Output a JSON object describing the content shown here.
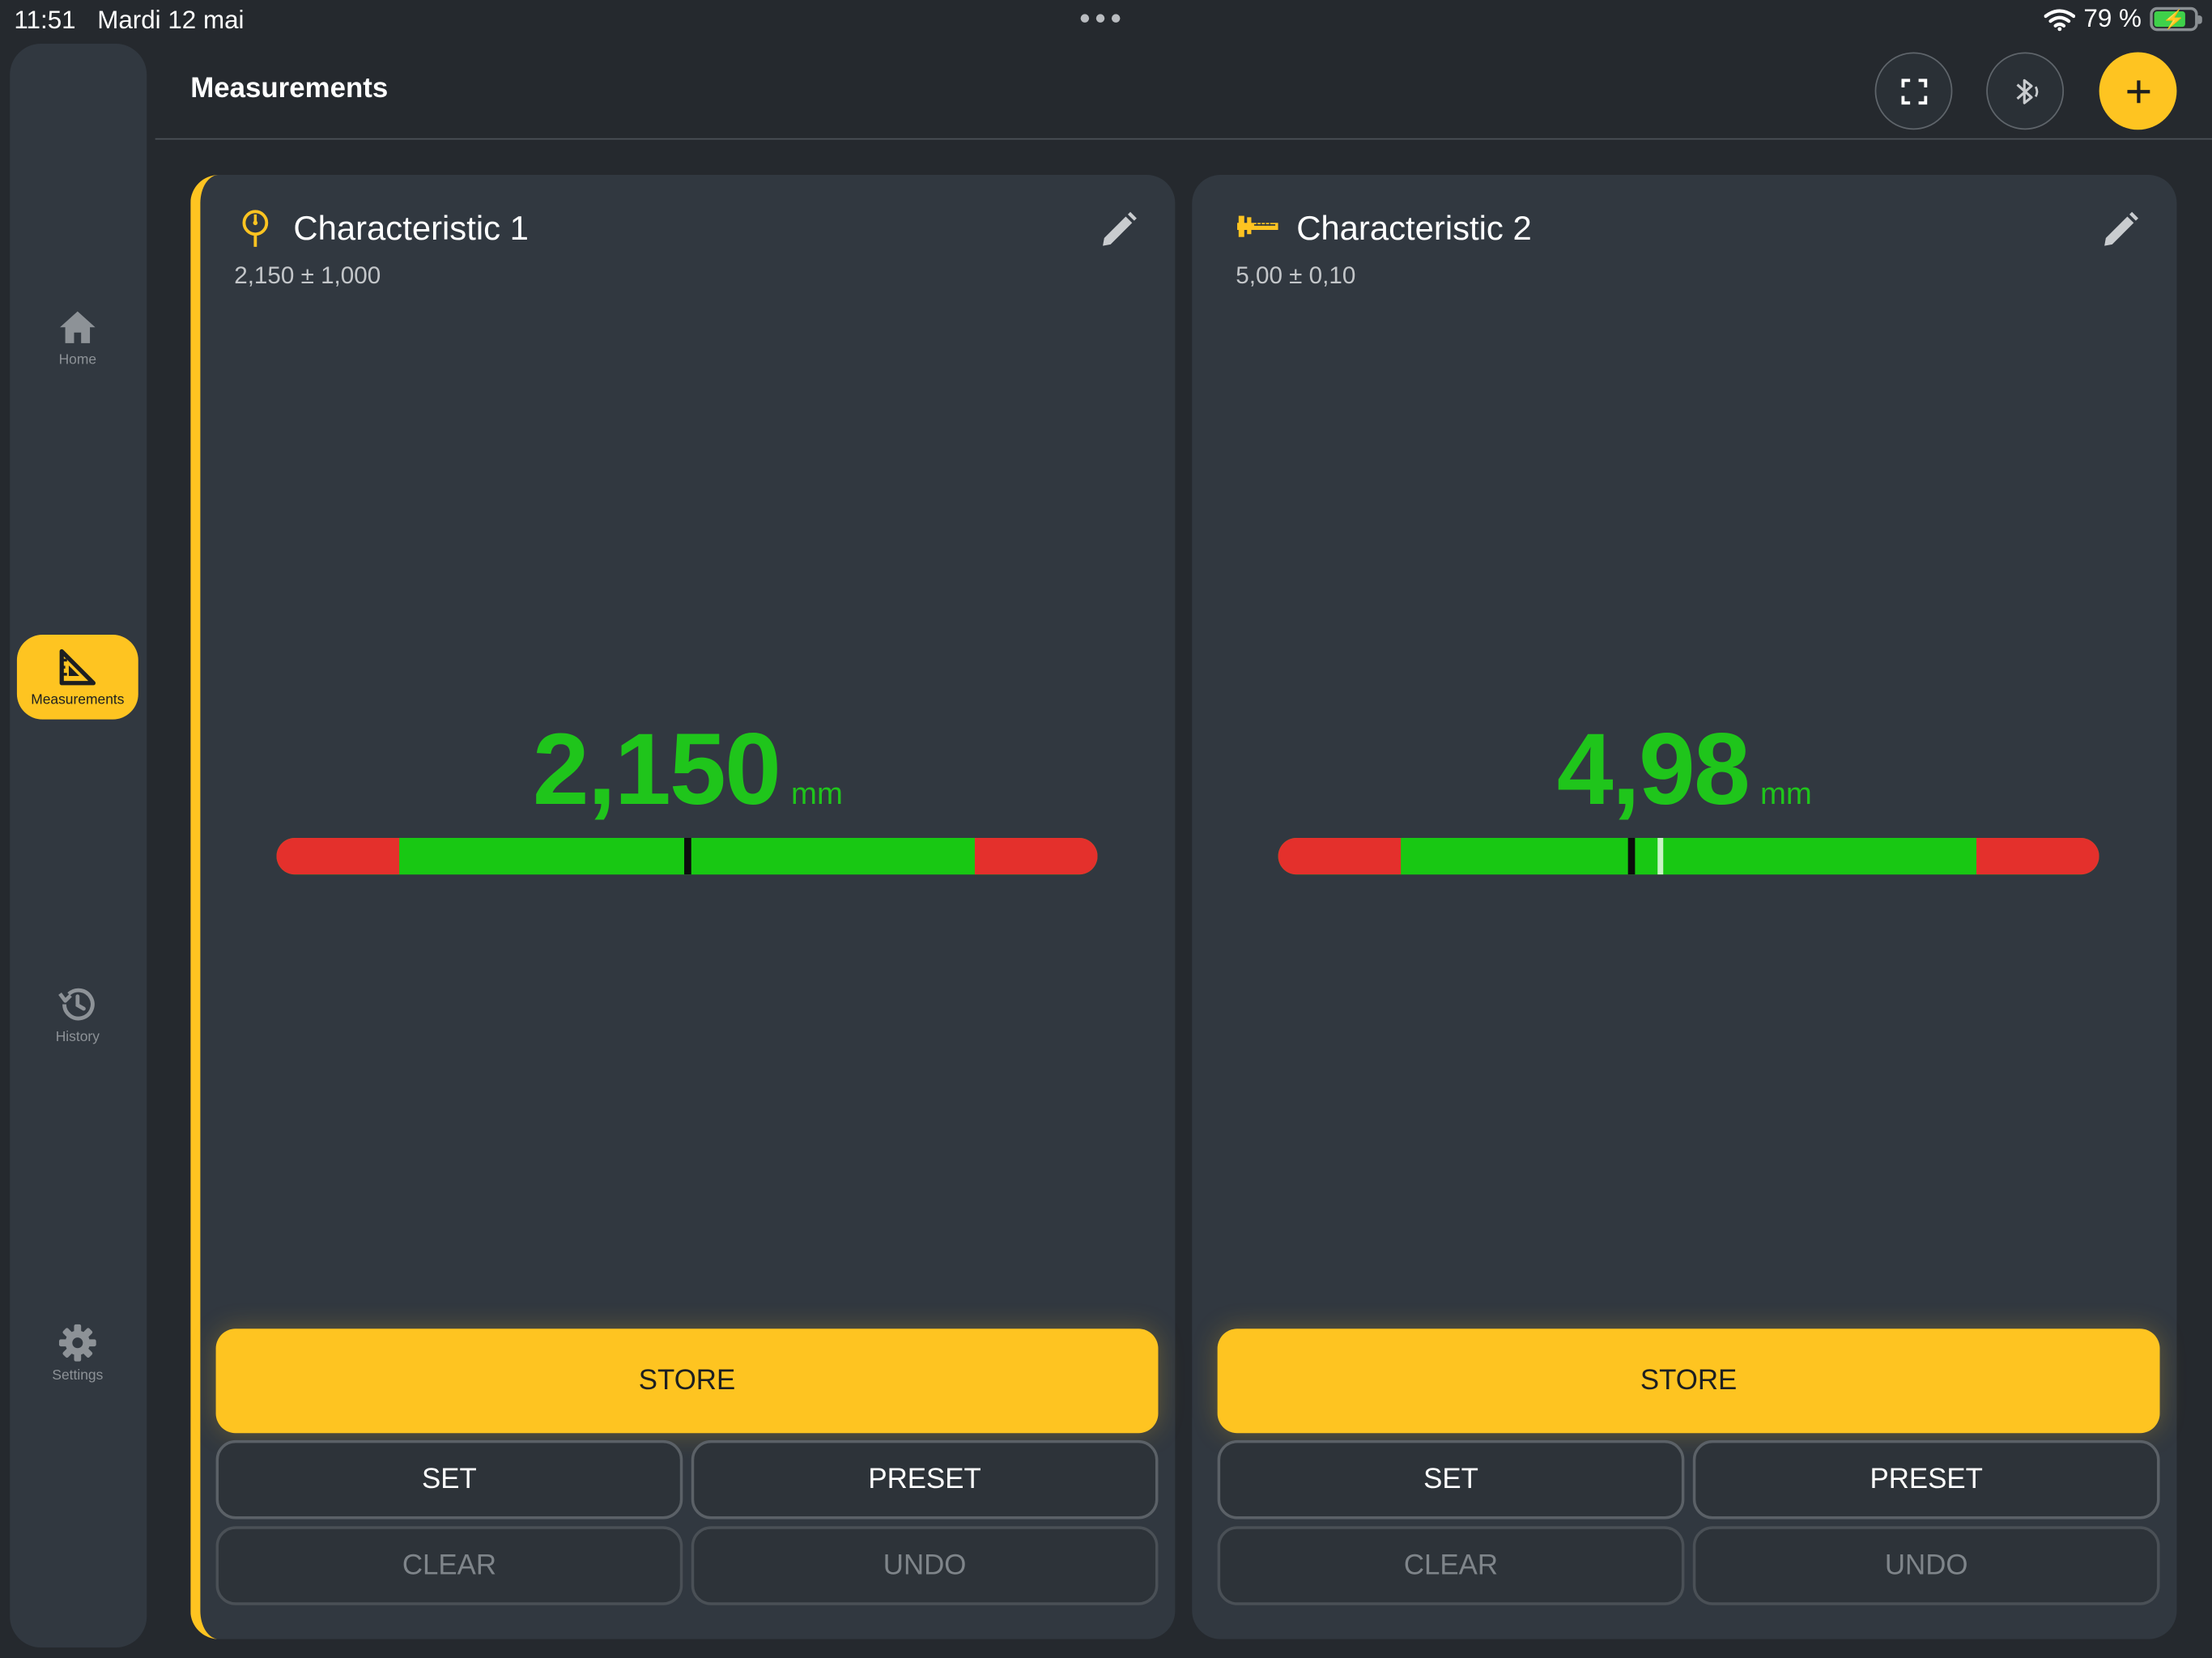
{
  "status_bar": {
    "time": "11:51",
    "date": "Mardi 12 mai",
    "battery": "79 %",
    "battery_level": 0.79
  },
  "sidebar": {
    "items": [
      {
        "label": "Home",
        "icon": "home-icon",
        "active": false
      },
      {
        "label": "Measurements",
        "icon": "measure-triangle-icon",
        "active": true
      },
      {
        "label": "History",
        "icon": "history-icon",
        "active": false
      },
      {
        "label": "Settings",
        "icon": "gear-icon",
        "active": false
      }
    ]
  },
  "header": {
    "title": "Measurements",
    "buttons": [
      "fullscreen-icon",
      "bluetooth-icon",
      "plus-icon"
    ]
  },
  "cards": [
    {
      "title": "Characteristic 1",
      "tolerance": "2,150 ± 1,000",
      "icon": "dial-indicator-icon",
      "reading": "2,150",
      "unit": "mm",
      "selected": true,
      "nominal": 2.15,
      "tolerance_value": 1.0,
      "value": 2.15,
      "store_label": "STORE",
      "set_label": "SET",
      "preset_label": "PRESET",
      "clear_label": "CLEAR",
      "undo_label": "UNDO"
    },
    {
      "title": "Characteristic 2",
      "tolerance": "5,00 ± 0,10",
      "icon": "caliper-icon",
      "reading": "4,98",
      "unit": "mm",
      "selected": false,
      "nominal": 5.0,
      "tolerance_value": 0.1,
      "value": 4.98,
      "store_label": "STORE",
      "set_label": "SET",
      "preset_label": "PRESET",
      "clear_label": "CLEAR",
      "undo_label": "UNDO"
    }
  ],
  "colors": {
    "accent": "#fec421",
    "in_tolerance": "#1fc51b",
    "out_of_tolerance": "#e4302c",
    "background": "#25292e",
    "card": "#313840"
  }
}
